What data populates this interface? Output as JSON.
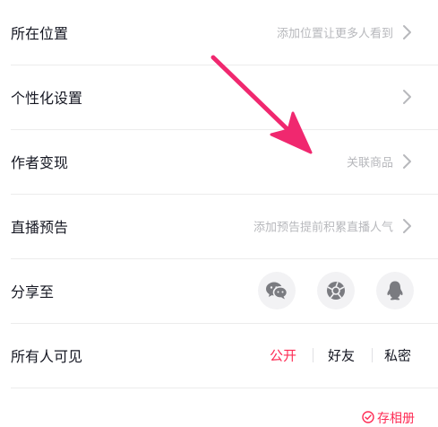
{
  "settings": {
    "location": {
      "label": "所在位置",
      "hint": "添加位置让更多人看到"
    },
    "personalize": {
      "label": "个性化设置"
    },
    "monetize": {
      "label": "作者变现",
      "hint": "关联商品"
    },
    "live_preview": {
      "label": "直播预告",
      "hint": "添加预告提前积累直播人气"
    },
    "share": {
      "label": "分享至",
      "targets": [
        {
          "icon": "wechat-icon"
        },
        {
          "icon": "moments-icon"
        },
        {
          "icon": "qq-icon"
        }
      ]
    },
    "visibility": {
      "label": "所有人可见",
      "options": [
        "公开",
        "好友",
        "私密"
      ],
      "selected": "公开"
    },
    "save_album": {
      "label": "存相册",
      "icon": "check-circle-icon"
    }
  },
  "colors": {
    "accent": "#fe2c55",
    "text_primary": "#161823",
    "text_hint": "#b7b8bc",
    "icon_gray": "#7a7b80",
    "divider": "#ececec",
    "annotation_arrow": "#f0286f"
  }
}
